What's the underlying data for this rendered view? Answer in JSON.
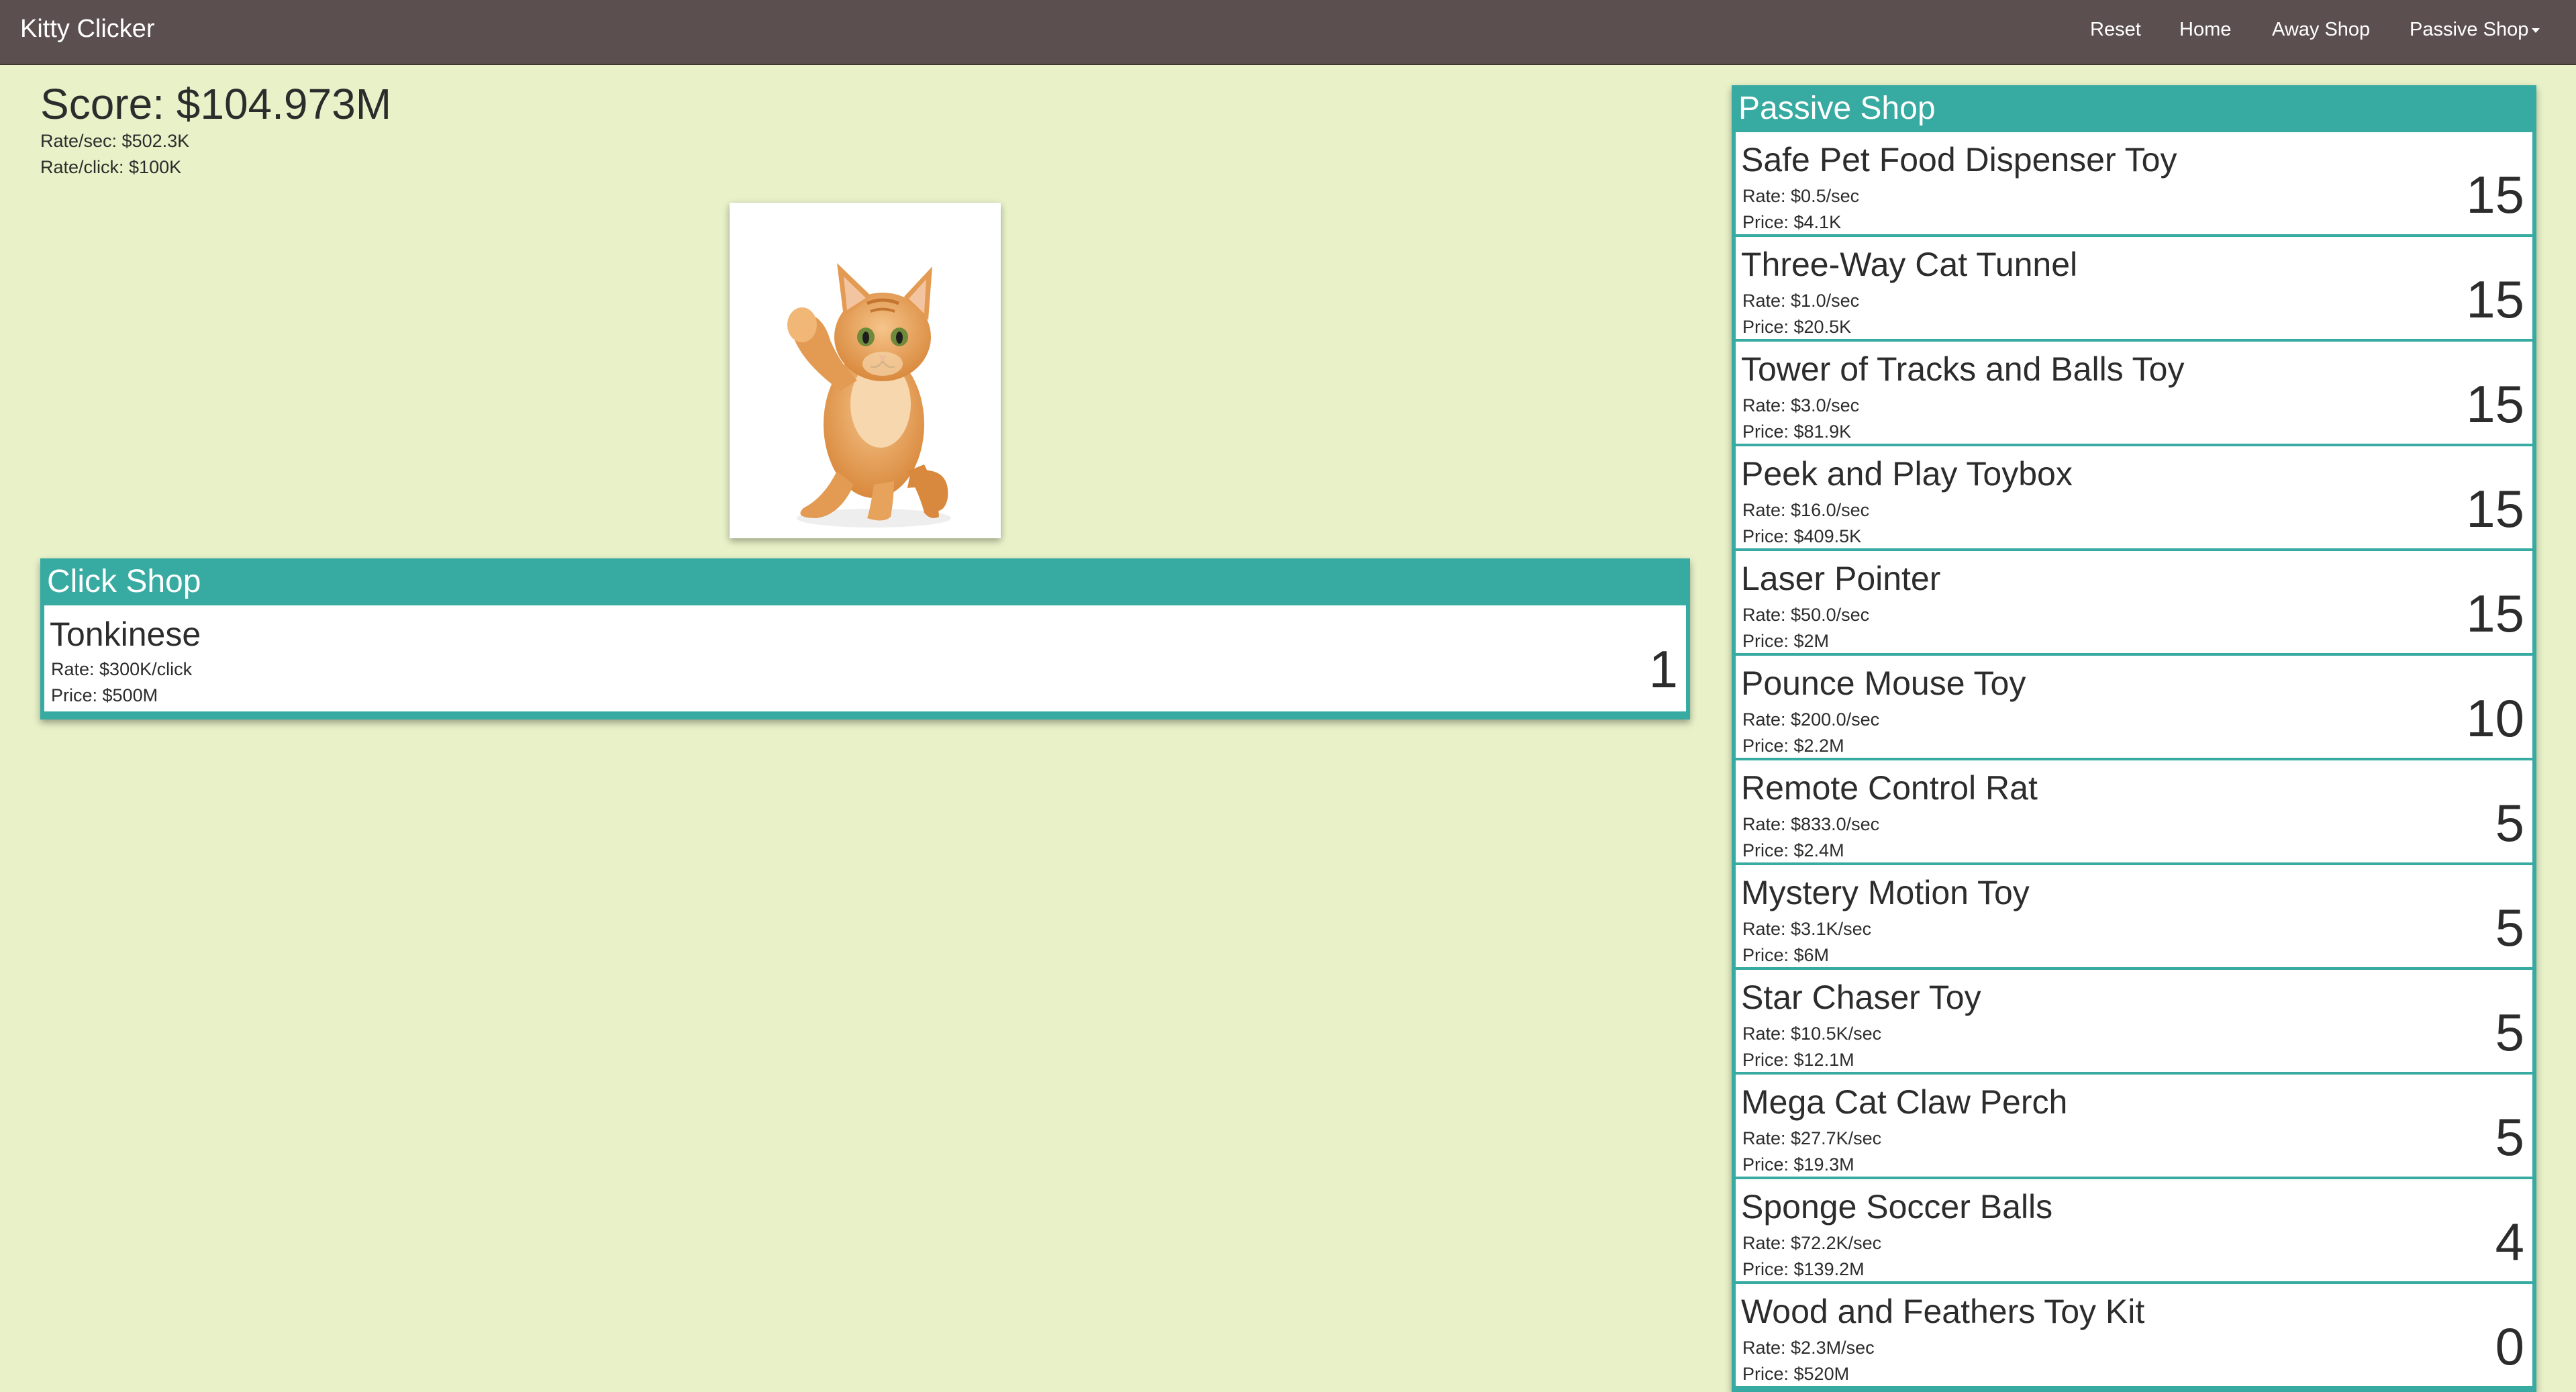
{
  "navbar": {
    "brand": "Kitty Clicker",
    "links": [
      {
        "label": "Reset"
      },
      {
        "label": "Home"
      },
      {
        "label": "Away Shop"
      },
      {
        "label": "Passive Shop"
      }
    ]
  },
  "stats": {
    "score": "Score: $104.973M",
    "rate_sec": "Rate/sec: $502.3K",
    "rate_click": "Rate/click: $100K"
  },
  "colors": {
    "background": "#e8f1c8",
    "navbar": "#5b4f4f",
    "accent": "#37aaa2"
  },
  "click_shop": {
    "title": "Click Shop",
    "items": [
      {
        "name": "Tonkinese",
        "rate": "Rate: $300K/click",
        "price": "Price: $500M",
        "count": "1"
      }
    ]
  },
  "passive_shop": {
    "title": "Passive Shop",
    "items": [
      {
        "name": "Safe Pet Food Dispenser Toy",
        "rate": "Rate: $0.5/sec",
        "price": "Price: $4.1K",
        "count": "15"
      },
      {
        "name": "Three-Way Cat Tunnel",
        "rate": "Rate: $1.0/sec",
        "price": "Price: $20.5K",
        "count": "15"
      },
      {
        "name": "Tower of Tracks and Balls Toy",
        "rate": "Rate: $3.0/sec",
        "price": "Price: $81.9K",
        "count": "15"
      },
      {
        "name": "Peek and Play Toybox",
        "rate": "Rate: $16.0/sec",
        "price": "Price: $409.5K",
        "count": "15"
      },
      {
        "name": "Laser Pointer",
        "rate": "Rate: $50.0/sec",
        "price": "Price: $2M",
        "count": "15"
      },
      {
        "name": "Pounce Mouse Toy",
        "rate": "Rate: $200.0/sec",
        "price": "Price: $2.2M",
        "count": "10"
      },
      {
        "name": "Remote Control Rat",
        "rate": "Rate: $833.0/sec",
        "price": "Price: $2.4M",
        "count": "5"
      },
      {
        "name": "Mystery Motion Toy",
        "rate": "Rate: $3.1K/sec",
        "price": "Price: $6M",
        "count": "5"
      },
      {
        "name": "Star Chaser Toy",
        "rate": "Rate: $10.5K/sec",
        "price": "Price: $12.1M",
        "count": "5"
      },
      {
        "name": "Mega Cat Claw Perch",
        "rate": "Rate: $27.7K/sec",
        "price": "Price: $19.3M",
        "count": "5"
      },
      {
        "name": "Sponge Soccer Balls",
        "rate": "Rate: $72.2K/sec",
        "price": "Price: $139.2M",
        "count": "4"
      },
      {
        "name": "Wood and Feathers Toy Kit",
        "rate": "Rate: $2.3M/sec",
        "price": "Price: $520M",
        "count": "0"
      }
    ]
  }
}
